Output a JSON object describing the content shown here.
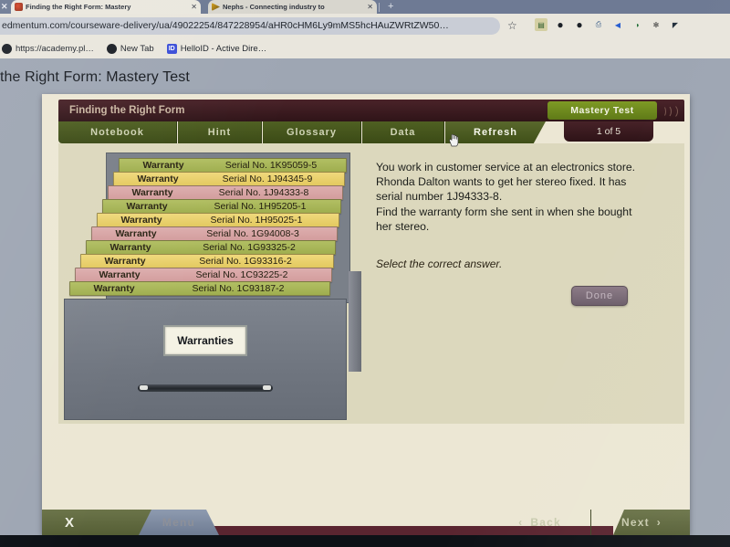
{
  "browser": {
    "tabs": [
      {
        "title": "Finding the Right Form: Mastery",
        "favicon": "edmentum-icon",
        "close": "✕"
      },
      {
        "title": "Nephs - Connecting industry to",
        "favicon": "nephs-icon",
        "close": "✕"
      }
    ],
    "new_tab_label": "+",
    "window_close_label": "✕",
    "url": "edmentum.com/courseware-delivery/ua/49022254/847228954/aHR0cHM6Ly9mMS5hcHAuZWRtZW50…",
    "bookmark_star": "☆",
    "extensions": [
      {
        "name": "reader-extension-icon",
        "glyph": "▤"
      },
      {
        "name": "shield-extension-icon",
        "glyph": "●"
      },
      {
        "name": "shield-extension-icon-2",
        "glyph": "●"
      },
      {
        "name": "printer-extension-icon",
        "glyph": "⎙"
      },
      {
        "name": "speaker-extension-icon",
        "glyph": "◀"
      },
      {
        "name": "contrast-extension-icon",
        "glyph": "◑"
      },
      {
        "name": "puzzle-extension-icon",
        "glyph": "✻"
      },
      {
        "name": "capture-extension-icon",
        "glyph": "◤"
      }
    ],
    "bookmarks": [
      {
        "label": "https://academy.pl…",
        "icon": "link-icon"
      },
      {
        "label": "New Tab",
        "icon": "globe-icon"
      },
      {
        "label": "HelloID - Active Dire…",
        "icon": "helloid-icon"
      }
    ]
  },
  "page": {
    "heading": "the Right Form: Mastery Test"
  },
  "app": {
    "title": "Finding the Right Form",
    "badge": "Mastery Test",
    "page_counter": "1 of 5",
    "nav_tabs": [
      {
        "label": "Notebook",
        "active": false
      },
      {
        "label": "Hint",
        "active": false
      },
      {
        "label": "Glossary",
        "active": false
      },
      {
        "label": "Data",
        "active": false
      },
      {
        "label": "Refresh",
        "active": true
      }
    ]
  },
  "cabinet": {
    "drawer_label": "Warranties",
    "folders": [
      {
        "label": "Warranty",
        "serial": "Serial No. 1K95059-5",
        "color": "green"
      },
      {
        "label": "Warranty",
        "serial": "Serial No. 1J94345-9",
        "color": "yellow"
      },
      {
        "label": "Warranty",
        "serial": "Serial No. 1J94333-8",
        "color": "pink"
      },
      {
        "label": "Warranty",
        "serial": "Serial No. 1H95205-1",
        "color": "green"
      },
      {
        "label": "Warranty",
        "serial": "Serial No. 1H95025-1",
        "color": "yellow"
      },
      {
        "label": "Warranty",
        "serial": "Serial No. 1G94008-3",
        "color": "pink"
      },
      {
        "label": "Warranty",
        "serial": "Serial No. 1G93325-2",
        "color": "green"
      },
      {
        "label": "Warranty",
        "serial": "Serial No. 1G93316-2",
        "color": "yellow"
      },
      {
        "label": "Warranty",
        "serial": "Serial No. 1C93225-2",
        "color": "pink"
      },
      {
        "label": "Warranty",
        "serial": "Serial No. 1C93187-2",
        "color": "green"
      }
    ]
  },
  "question": {
    "lines": [
      "You work in customer service at an electronics store.",
      "Rhonda Dalton wants to get her stereo fixed. It has",
      "serial number 1J94333-8.",
      "Find the warranty form she sent in when she bought",
      "her stereo."
    ],
    "prompt": "Select the correct answer.",
    "done_label": "Done"
  },
  "bottom_bar": {
    "close_label": "X",
    "menu_label": "Menu",
    "back_label": "Back",
    "next_label": "Next",
    "back_chevron": "‹",
    "next_chevron": "›"
  },
  "colors": {
    "accent_green": "#7e9a25",
    "title_maroon": "#2f1418",
    "nav_olive": "#4f6022",
    "folder_green": "#b2bf63",
    "folder_yellow": "#f0d97c",
    "folder_pink": "#ddaeae",
    "page_bg": "#dcd8bd"
  }
}
